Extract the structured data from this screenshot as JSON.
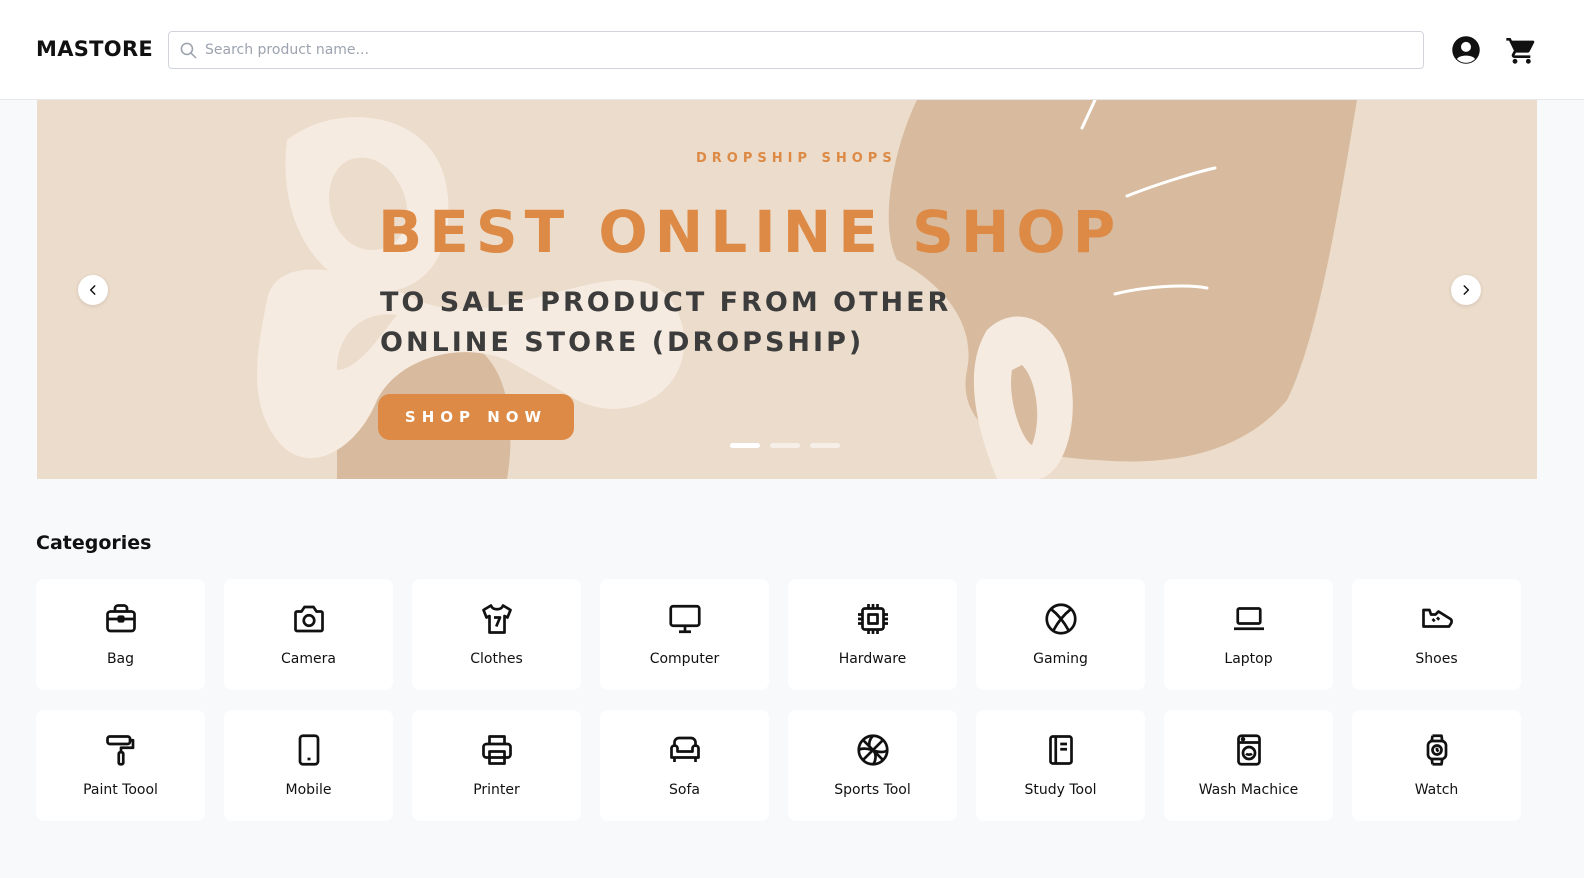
{
  "header": {
    "logo": "MASTORE",
    "search_placeholder": "Search product name...",
    "icons": [
      "search-icon",
      "user-icon",
      "cart-icon"
    ]
  },
  "hero": {
    "kicker": "DROPSHIP SHOPS",
    "title": "BEST ONLINE SHOP",
    "subtitle_line1": "TO SALE PRODUCT FROM OTHER",
    "subtitle_line2": "ONLINE STORE (DROPSHIP)",
    "cta": "SHOP NOW",
    "slides": 3,
    "active_slide": 1,
    "colors": {
      "background": "#ecdccb",
      "accent": "#dc8a45",
      "shape": "#d8bb9e"
    }
  },
  "categories": {
    "title": "Categories",
    "items": [
      {
        "label": "Bag",
        "icon": "bag-icon"
      },
      {
        "label": "Camera",
        "icon": "camera-icon"
      },
      {
        "label": "Clothes",
        "icon": "shirt-icon"
      },
      {
        "label": "Computer",
        "icon": "monitor-icon"
      },
      {
        "label": "Hardware",
        "icon": "chip-icon"
      },
      {
        "label": "Gaming",
        "icon": "xbox-icon"
      },
      {
        "label": "Laptop",
        "icon": "laptop-icon"
      },
      {
        "label": "Shoes",
        "icon": "shoe-icon"
      },
      {
        "label": "Paint Toool",
        "icon": "paint-roller-icon"
      },
      {
        "label": "Mobile",
        "icon": "phone-icon"
      },
      {
        "label": "Printer",
        "icon": "printer-icon"
      },
      {
        "label": "Sofa",
        "icon": "sofa-icon"
      },
      {
        "label": "Sports Tool",
        "icon": "basketball-icon"
      },
      {
        "label": "Study Tool",
        "icon": "notebook-icon"
      },
      {
        "label": "Wash Machice",
        "icon": "washing-machine-icon"
      },
      {
        "label": "Watch",
        "icon": "watch-icon"
      }
    ]
  }
}
